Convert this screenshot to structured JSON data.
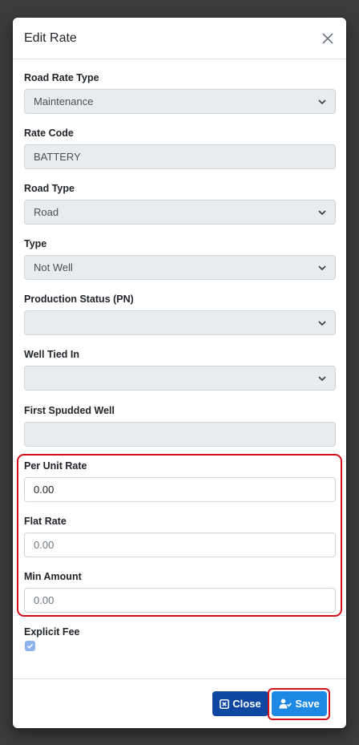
{
  "modal": {
    "title": "Edit Rate"
  },
  "fields": {
    "road_rate_type": {
      "label": "Road Rate Type",
      "value": "Maintenance"
    },
    "rate_code": {
      "label": "Rate Code",
      "value": "BATTERY"
    },
    "road_type": {
      "label": "Road Type",
      "value": "Road"
    },
    "type": {
      "label": "Type",
      "value": "Not Well"
    },
    "production_status": {
      "label": "Production Status (PN)",
      "value": ""
    },
    "well_tied_in": {
      "label": "Well Tied In",
      "value": ""
    },
    "first_spudded_well": {
      "label": "First Spudded Well",
      "value": ""
    },
    "per_unit_rate": {
      "label": "Per Unit Rate",
      "value": "0.00"
    },
    "flat_rate": {
      "label": "Flat Rate",
      "value": "0.00"
    },
    "min_amount": {
      "label": "Min Amount",
      "value": "0.00"
    },
    "explicit_fee": {
      "label": "Explicit Fee",
      "checked": true
    }
  },
  "footer": {
    "close_label": "Close",
    "save_label": "Save"
  },
  "colors": {
    "highlight": "#d4101a",
    "close_button": "#0d47a1",
    "save_button": "#1e88e5",
    "disabled_bg": "#e9ecef"
  }
}
